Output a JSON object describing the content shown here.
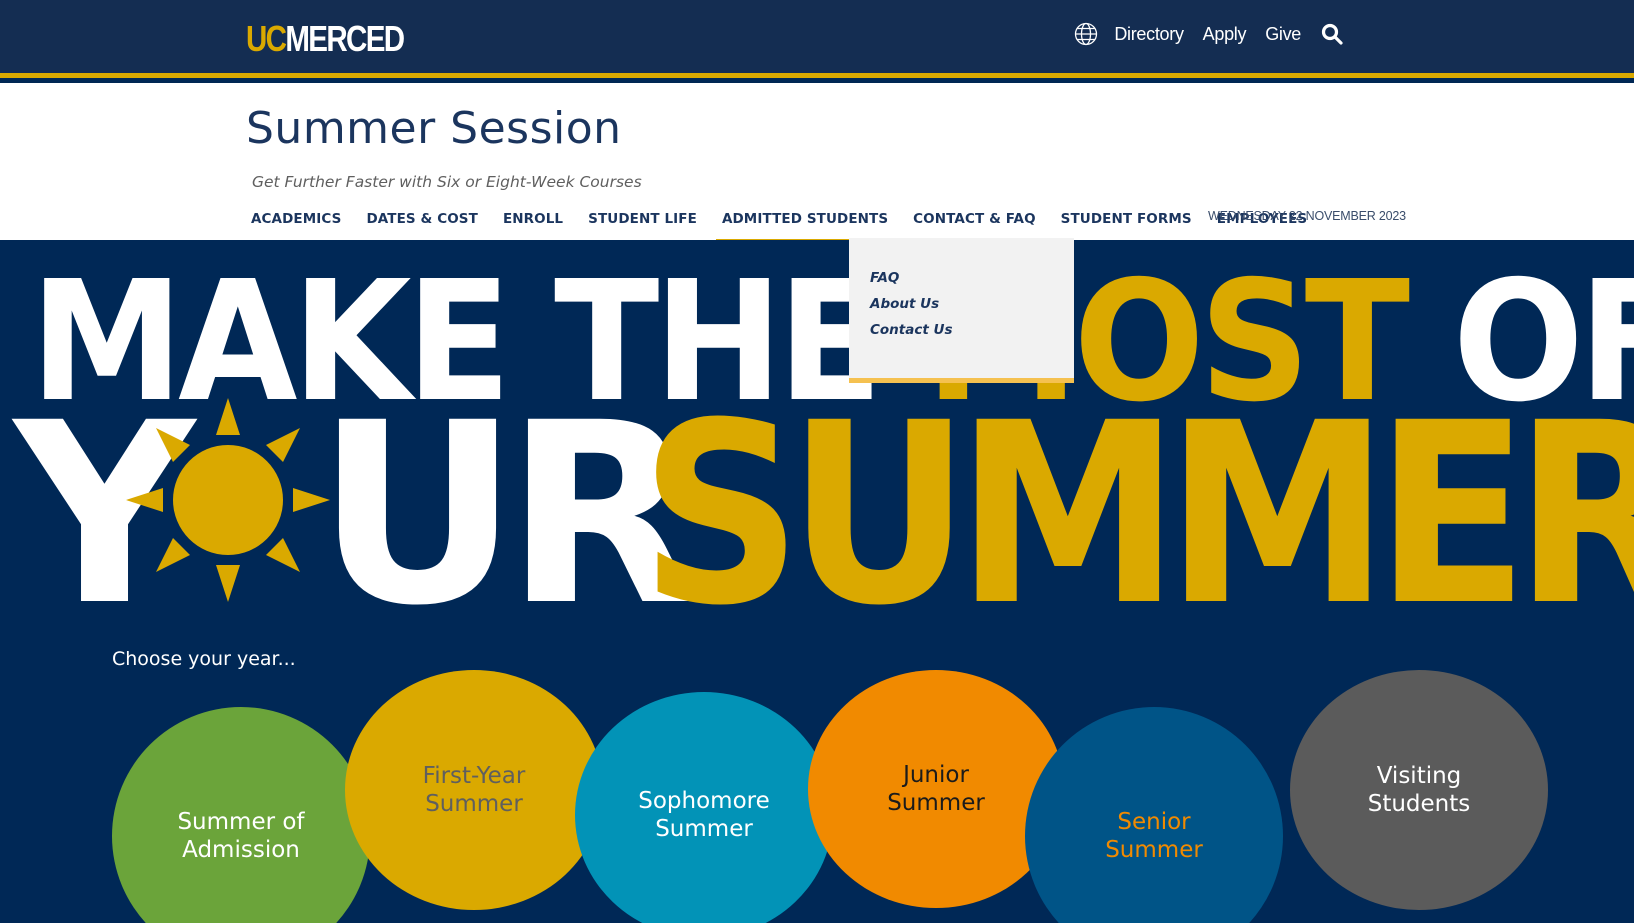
{
  "topbar": {
    "logo_uc": "UC",
    "logo_merced": "MERCED",
    "links": [
      "Directory",
      "Apply",
      "Give"
    ],
    "globe_icon": "globe-icon",
    "search_icon": "search-icon"
  },
  "header": {
    "title": "Summer Session",
    "tagline": "Get Further Faster with Six or Eight-Week Courses",
    "nav": [
      "ACADEMICS",
      "DATES & COST",
      "ENROLL",
      "STUDENT LIFE",
      "ADMITTED STUDENTS",
      "CONTACT & FAQ",
      "STUDENT FORMS",
      "EMPLOYEES"
    ],
    "active_nav": "ADMITTED STUDENTS",
    "date": "WEDNESDAY 22 NOVEMBER 2023"
  },
  "dropdown": {
    "items": [
      "FAQ",
      "About Us",
      "Contact Us"
    ]
  },
  "hero": {
    "line1_white": "MAKE THE ",
    "line1_gold": "MOST",
    "line1_white2": " OF",
    "line2_y": "Y",
    "line2_ur": "UR",
    "line2_summer": "SUMMER",
    "choose": "Choose your year...",
    "circles": [
      {
        "label1": "Summer of",
        "label2": "Admission"
      },
      {
        "label1": "First-Year",
        "label2": "Summer"
      },
      {
        "label1": "Sophomore",
        "label2": "Summer"
      },
      {
        "label1": "Junior",
        "label2": "Summer"
      },
      {
        "label1": "Senior",
        "label2": "Summer"
      },
      {
        "label1": "Visiting",
        "label2": "Students"
      }
    ]
  },
  "colors": {
    "navy": "#002856",
    "gold": "#daa900",
    "green": "#6ba43a",
    "teal": "#0293b7",
    "orange": "#f18a00",
    "blue": "#005487",
    "gray": "#5b5b5b"
  }
}
